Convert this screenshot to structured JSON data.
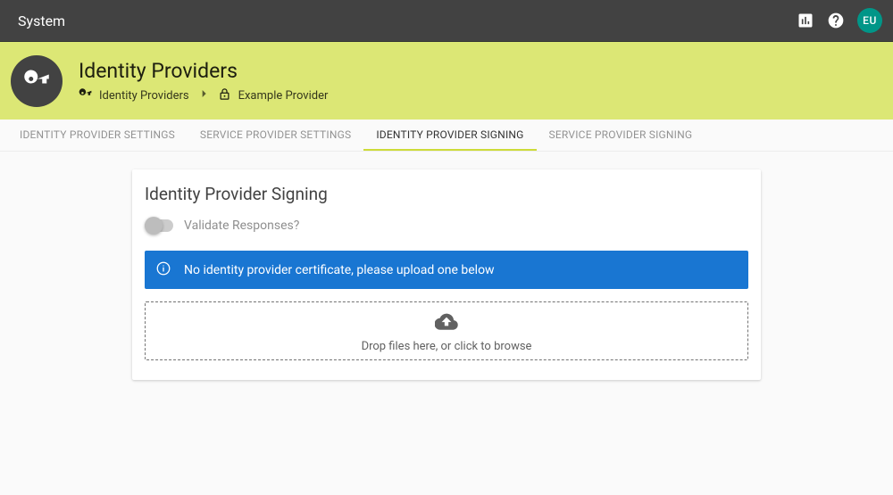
{
  "topbar": {
    "title": "System",
    "avatar_initials": "EU"
  },
  "header": {
    "page_title": "Identity Providers",
    "breadcrumbs": {
      "root": "Identity Providers",
      "current": "Example Provider"
    }
  },
  "tabs": [
    {
      "label": "Identity Provider Settings"
    },
    {
      "label": "Service Provider Settings"
    },
    {
      "label": "Identity Provider Signing"
    },
    {
      "label": "Service Provider Signing"
    }
  ],
  "active_tab_index": 2,
  "card": {
    "title": "Identity Provider Signing",
    "toggle_label": "Validate Responses?",
    "info_message": "No identity provider certificate, please upload one below",
    "dropzone_label": "Drop files here, or click to browse"
  }
}
